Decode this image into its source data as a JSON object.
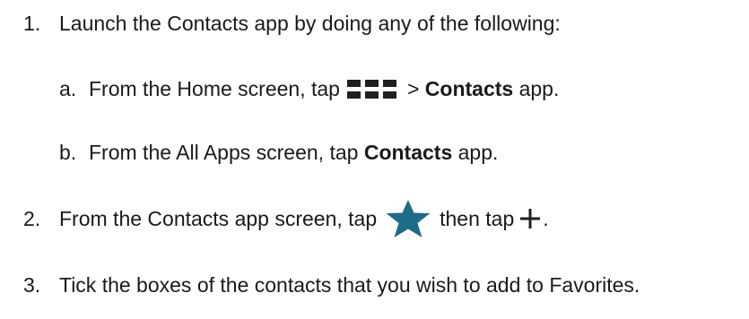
{
  "steps": {
    "s1": {
      "num": "1.",
      "text": "Launch the Contacts app by doing any of the following:"
    },
    "s1a": {
      "num": "a.",
      "pre": "From the Home screen, tap",
      "gt": ">",
      "bold": "Contacts",
      "post": "app.",
      "icon": "apps-grid-icon"
    },
    "s1b": {
      "num": "b.",
      "pre": "From the All Apps screen, tap",
      "bold": "Contacts",
      "post": "app."
    },
    "s2": {
      "num": "2.",
      "pre": "From the Contacts app screen, tap",
      "mid": "then tap",
      "post": ".",
      "icon1": "favorite-star-icon",
      "icon2": "add-plus-icon"
    },
    "s3": {
      "num": "3.",
      "text": "Tick the boxes of the contacts that you wish to add to Favorites."
    }
  },
  "colors": {
    "text": "#1a1a1a",
    "star": "#1e6c85",
    "icon": "#1f1f1f"
  }
}
